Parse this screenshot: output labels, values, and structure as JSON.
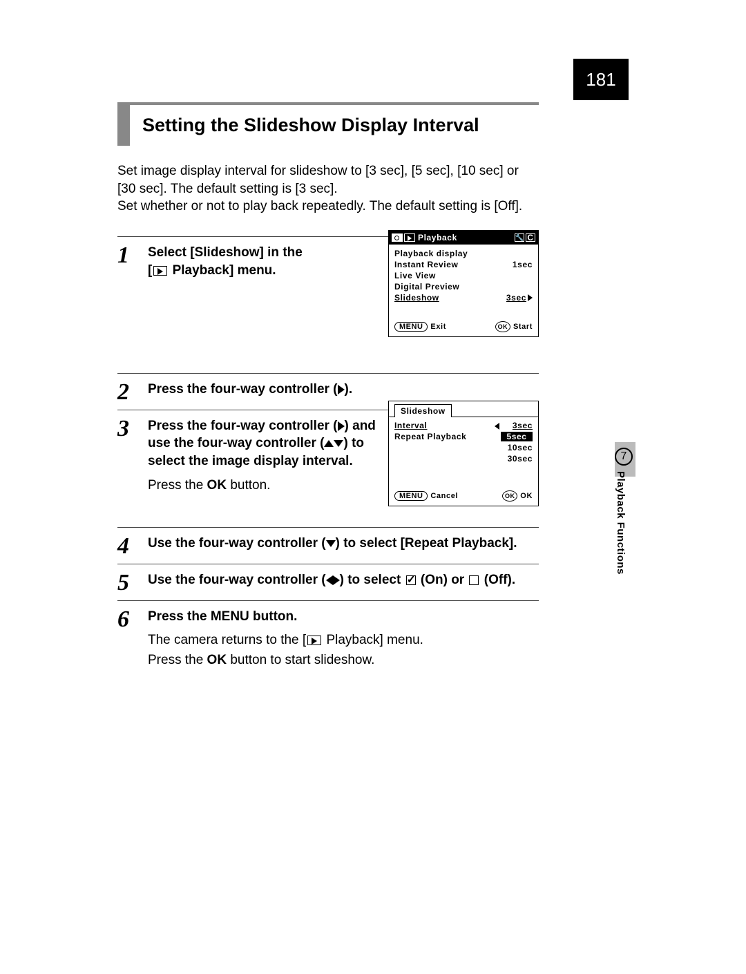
{
  "page_number": "181",
  "chapter": {
    "number": "7",
    "title": "Playback Functions"
  },
  "title": "Setting the Slideshow Display Interval",
  "intro_line1": "Set image display interval for slideshow to [3 sec], [5 sec], [10 sec] or [30 sec]. The default setting is [3 sec].",
  "intro_line2": "Set whether or not to play back repeatedly. The default setting is [Off].",
  "steps": [
    {
      "num": "1",
      "text_a": "Select [Slideshow] in the",
      "text_b": "[",
      "text_c": " Playback] menu."
    },
    {
      "num": "2",
      "text": "Press the four-way controller (",
      "text_end": ")."
    },
    {
      "num": "3",
      "text_a": "Press the four-way controller (",
      "text_b": ") and use the four-way controller (",
      "text_c": ") to select the image display interval.",
      "note_a": "Press the ",
      "note_b": "OK",
      "note_c": " button."
    },
    {
      "num": "4",
      "text_a": "Use the four-way controller (",
      "text_b": ") to select [Repeat Playback]."
    },
    {
      "num": "5",
      "text_a": "Use the four-way controller (",
      "text_b": ") to select ",
      "text_c": " (On) or ",
      "text_d": " (Off)."
    },
    {
      "num": "6",
      "text_a": "Press the ",
      "text_b": "MENU",
      "text_c": " button.",
      "note_a": "The camera returns to the [",
      "note_b": " Playback] menu.",
      "note_c": "Press the ",
      "note_d": "OK",
      "note_e": " button to start slideshow."
    }
  ],
  "screen1": {
    "header": "Playback",
    "items": [
      {
        "label": "Playback display",
        "value": ""
      },
      {
        "label": "Instant Review",
        "value": "1sec"
      },
      {
        "label": "Live View",
        "value": ""
      },
      {
        "label": "Digital Preview",
        "value": ""
      },
      {
        "label": "Slideshow",
        "value": "3sec",
        "selected": true
      }
    ],
    "footer_left_btn": "MENU",
    "footer_left": "Exit",
    "footer_right_btn": "OK",
    "footer_right": "Start"
  },
  "screen2": {
    "tab": "Slideshow",
    "rows": [
      {
        "label": "Interval",
        "value": "3sec",
        "selected": true,
        "arrow": true
      },
      {
        "label": "Repeat Playback",
        "value": "5sec",
        "highlighted": true
      },
      {
        "label": "",
        "value": "10sec"
      },
      {
        "label": "",
        "value": "30sec"
      }
    ],
    "footer_left_btn": "MENU",
    "footer_left": "Cancel",
    "footer_right_btn": "OK",
    "footer_right": "OK"
  }
}
